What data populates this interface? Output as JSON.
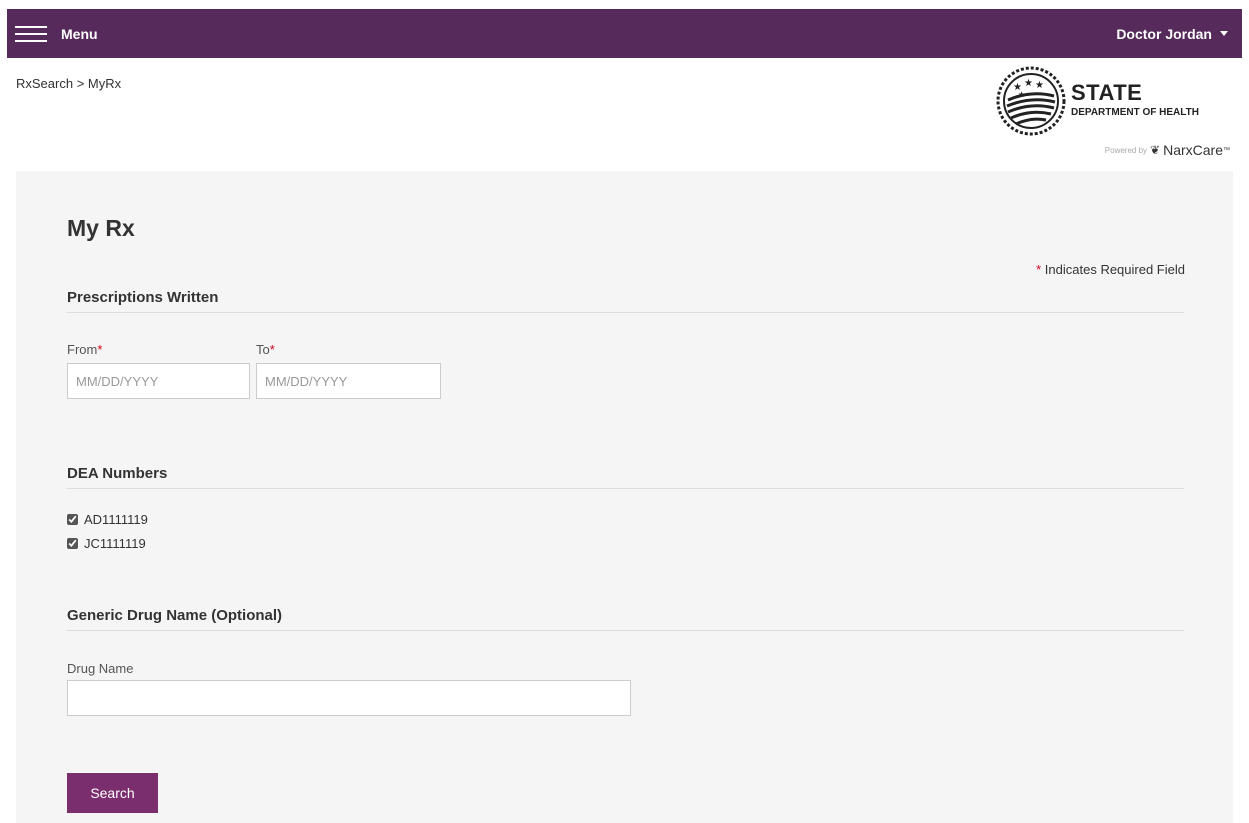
{
  "topbar": {
    "menu_label": "Menu",
    "user_name": "Doctor Jordan",
    "background": "#562a5a"
  },
  "breadcrumb": {
    "root": "RxSearch",
    "separator": ">",
    "current": "MyRx"
  },
  "logo": {
    "title": "STATE",
    "subtitle": "DEPARTMENT OF HEALTH",
    "powered_by": "Powered by",
    "brand": "NarxCare",
    "trademark": "™"
  },
  "page": {
    "title": "My Rx",
    "required_note": "Indicates Required Field",
    "required_marker": "*"
  },
  "prescriptions": {
    "heading": "Prescriptions Written",
    "from_label": "From",
    "to_label": "To",
    "from_placeholder": "MM/DD/YYYY",
    "to_placeholder": "MM/DD/YYYY"
  },
  "dea": {
    "heading": "DEA Numbers",
    "numbers": [
      {
        "label": "AD1111119",
        "checked": true
      },
      {
        "label": "JC1111119",
        "checked": true
      }
    ]
  },
  "drug": {
    "heading": "Generic Drug Name (Optional)",
    "label": "Drug Name",
    "value": ""
  },
  "actions": {
    "search_label": "Search",
    "button_color": "#7b2e6e"
  }
}
